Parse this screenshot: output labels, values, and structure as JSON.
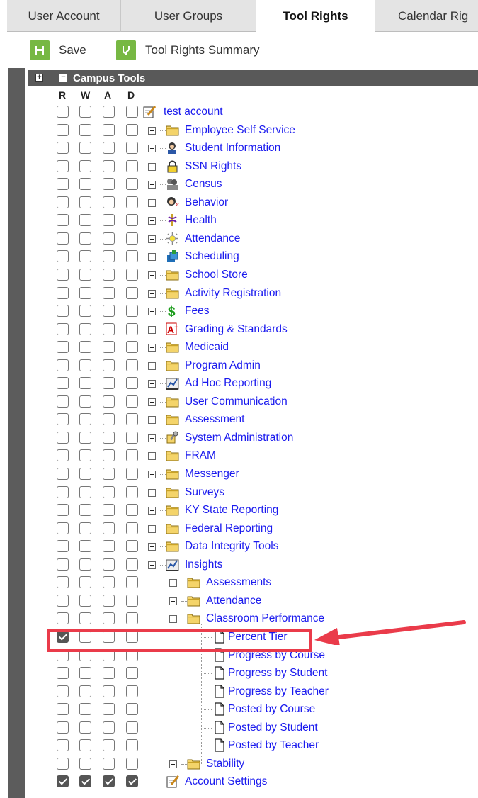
{
  "tabs": [
    {
      "label": "User Account",
      "active": false
    },
    {
      "label": "User Groups",
      "active": false
    },
    {
      "label": "Tool Rights",
      "active": true
    },
    {
      "label": "Calendar Rig",
      "active": false
    }
  ],
  "toolbar": {
    "save_label": "Save",
    "summary_label": "Tool Rights Summary"
  },
  "panel": {
    "title": "Campus Tools"
  },
  "columns": [
    "R",
    "W",
    "A",
    "D"
  ],
  "tree": [
    {
      "label": "test account",
      "level": 0,
      "expander": "none",
      "icon": "edit-note-icon",
      "checks": [
        false,
        false,
        false,
        false
      ]
    },
    {
      "label": "Employee Self Service",
      "level": 1,
      "expander": "closed",
      "icon": "folder-icon",
      "checks": [
        false,
        false,
        false,
        false
      ]
    },
    {
      "label": "Student Information",
      "level": 1,
      "expander": "closed",
      "icon": "student-icon",
      "checks": [
        false,
        false,
        false,
        false
      ]
    },
    {
      "label": "SSN Rights",
      "level": 1,
      "expander": "closed",
      "icon": "lock-icon",
      "checks": [
        false,
        false,
        false,
        false
      ]
    },
    {
      "label": "Census",
      "level": 1,
      "expander": "closed",
      "icon": "census-icon",
      "checks": [
        false,
        false,
        false,
        false
      ]
    },
    {
      "label": "Behavior",
      "level": 1,
      "expander": "closed",
      "icon": "behavior-icon",
      "checks": [
        false,
        false,
        false,
        false
      ]
    },
    {
      "label": "Health",
      "level": 1,
      "expander": "closed",
      "icon": "health-icon",
      "checks": [
        false,
        false,
        false,
        false
      ]
    },
    {
      "label": "Attendance",
      "level": 1,
      "expander": "closed",
      "icon": "attendance-icon",
      "checks": [
        false,
        false,
        false,
        false
      ]
    },
    {
      "label": "Scheduling",
      "level": 1,
      "expander": "closed",
      "icon": "scheduling-icon",
      "checks": [
        false,
        false,
        false,
        false
      ]
    },
    {
      "label": "School Store",
      "level": 1,
      "expander": "closed",
      "icon": "folder-icon",
      "checks": [
        false,
        false,
        false,
        false
      ]
    },
    {
      "label": "Activity Registration",
      "level": 1,
      "expander": "closed",
      "icon": "folder-icon",
      "checks": [
        false,
        false,
        false,
        false
      ]
    },
    {
      "label": "Fees",
      "level": 1,
      "expander": "closed",
      "icon": "dollar-icon",
      "checks": [
        false,
        false,
        false,
        false
      ]
    },
    {
      "label": "Grading & Standards",
      "level": 1,
      "expander": "closed",
      "icon": "grade-icon",
      "checks": [
        false,
        false,
        false,
        false
      ]
    },
    {
      "label": "Medicaid",
      "level": 1,
      "expander": "closed",
      "icon": "folder-icon",
      "checks": [
        false,
        false,
        false,
        false
      ]
    },
    {
      "label": "Program Admin",
      "level": 1,
      "expander": "closed",
      "icon": "folder-icon",
      "checks": [
        false,
        false,
        false,
        false
      ]
    },
    {
      "label": "Ad Hoc Reporting",
      "level": 1,
      "expander": "closed",
      "icon": "report-icon",
      "checks": [
        false,
        false,
        false,
        false
      ]
    },
    {
      "label": "User Communication",
      "level": 1,
      "expander": "closed",
      "icon": "folder-icon",
      "checks": [
        false,
        false,
        false,
        false
      ]
    },
    {
      "label": "Assessment",
      "level": 1,
      "expander": "closed",
      "icon": "folder-icon",
      "checks": [
        false,
        false,
        false,
        false
      ]
    },
    {
      "label": "System Administration",
      "level": 1,
      "expander": "closed",
      "icon": "tools-icon",
      "checks": [
        false,
        false,
        false,
        false
      ]
    },
    {
      "label": "FRAM",
      "level": 1,
      "expander": "closed",
      "icon": "folder-icon",
      "checks": [
        false,
        false,
        false,
        false
      ]
    },
    {
      "label": "Messenger",
      "level": 1,
      "expander": "closed",
      "icon": "folder-icon",
      "checks": [
        false,
        false,
        false,
        false
      ]
    },
    {
      "label": "Surveys",
      "level": 1,
      "expander": "closed",
      "icon": "folder-icon",
      "checks": [
        false,
        false,
        false,
        false
      ]
    },
    {
      "label": "KY State Reporting",
      "level": 1,
      "expander": "closed",
      "icon": "folder-icon",
      "checks": [
        false,
        false,
        false,
        false
      ]
    },
    {
      "label": "Federal Reporting",
      "level": 1,
      "expander": "closed",
      "icon": "folder-icon",
      "checks": [
        false,
        false,
        false,
        false
      ]
    },
    {
      "label": "Data Integrity Tools",
      "level": 1,
      "expander": "closed",
      "icon": "folder-icon",
      "checks": [
        false,
        false,
        false,
        false
      ]
    },
    {
      "label": "Insights",
      "level": 1,
      "expander": "open",
      "icon": "report-icon",
      "checks": [
        false,
        false,
        false,
        false
      ]
    },
    {
      "label": "Assessments",
      "level": 2,
      "expander": "closed",
      "icon": "folder-icon",
      "checks": [
        false,
        false,
        false,
        false
      ]
    },
    {
      "label": "Attendance",
      "level": 2,
      "expander": "closed",
      "icon": "folder-icon",
      "checks": [
        false,
        false,
        false,
        false
      ]
    },
    {
      "label": "Classroom Performance",
      "level": 2,
      "expander": "open",
      "icon": "folder-icon",
      "checks": [
        false,
        false,
        false,
        false
      ]
    },
    {
      "label": "Percent Tier",
      "level": 3,
      "expander": "none",
      "icon": "document-icon",
      "checks": [
        true,
        false,
        false,
        false
      ]
    },
    {
      "label": "Progress by Course",
      "level": 3,
      "expander": "none",
      "icon": "document-icon",
      "checks": [
        false,
        false,
        false,
        false
      ]
    },
    {
      "label": "Progress by Student",
      "level": 3,
      "expander": "none",
      "icon": "document-icon",
      "checks": [
        false,
        false,
        false,
        false
      ]
    },
    {
      "label": "Progress by Teacher",
      "level": 3,
      "expander": "none",
      "icon": "document-icon",
      "checks": [
        false,
        false,
        false,
        false
      ]
    },
    {
      "label": "Posted by Course",
      "level": 3,
      "expander": "none",
      "icon": "document-icon",
      "checks": [
        false,
        false,
        false,
        false
      ]
    },
    {
      "label": "Posted by Student",
      "level": 3,
      "expander": "none",
      "icon": "document-icon",
      "checks": [
        false,
        false,
        false,
        false
      ]
    },
    {
      "label": "Posted by Teacher",
      "level": 3,
      "expander": "none",
      "icon": "document-icon",
      "checks": [
        false,
        false,
        false,
        false
      ]
    },
    {
      "label": "Stability",
      "level": 2,
      "expander": "closed",
      "icon": "folder-icon",
      "checks": [
        false,
        false,
        false,
        false
      ]
    },
    {
      "label": "Account Settings",
      "level": 1,
      "expander": "none",
      "icon": "edit-note-icon",
      "checks": [
        true,
        true,
        true,
        true
      ]
    }
  ],
  "colors": {
    "accent_green": "#77b843",
    "header_bg": "#595959",
    "link_blue": "#1a1aee",
    "highlight_red": "#ea3b4a"
  }
}
